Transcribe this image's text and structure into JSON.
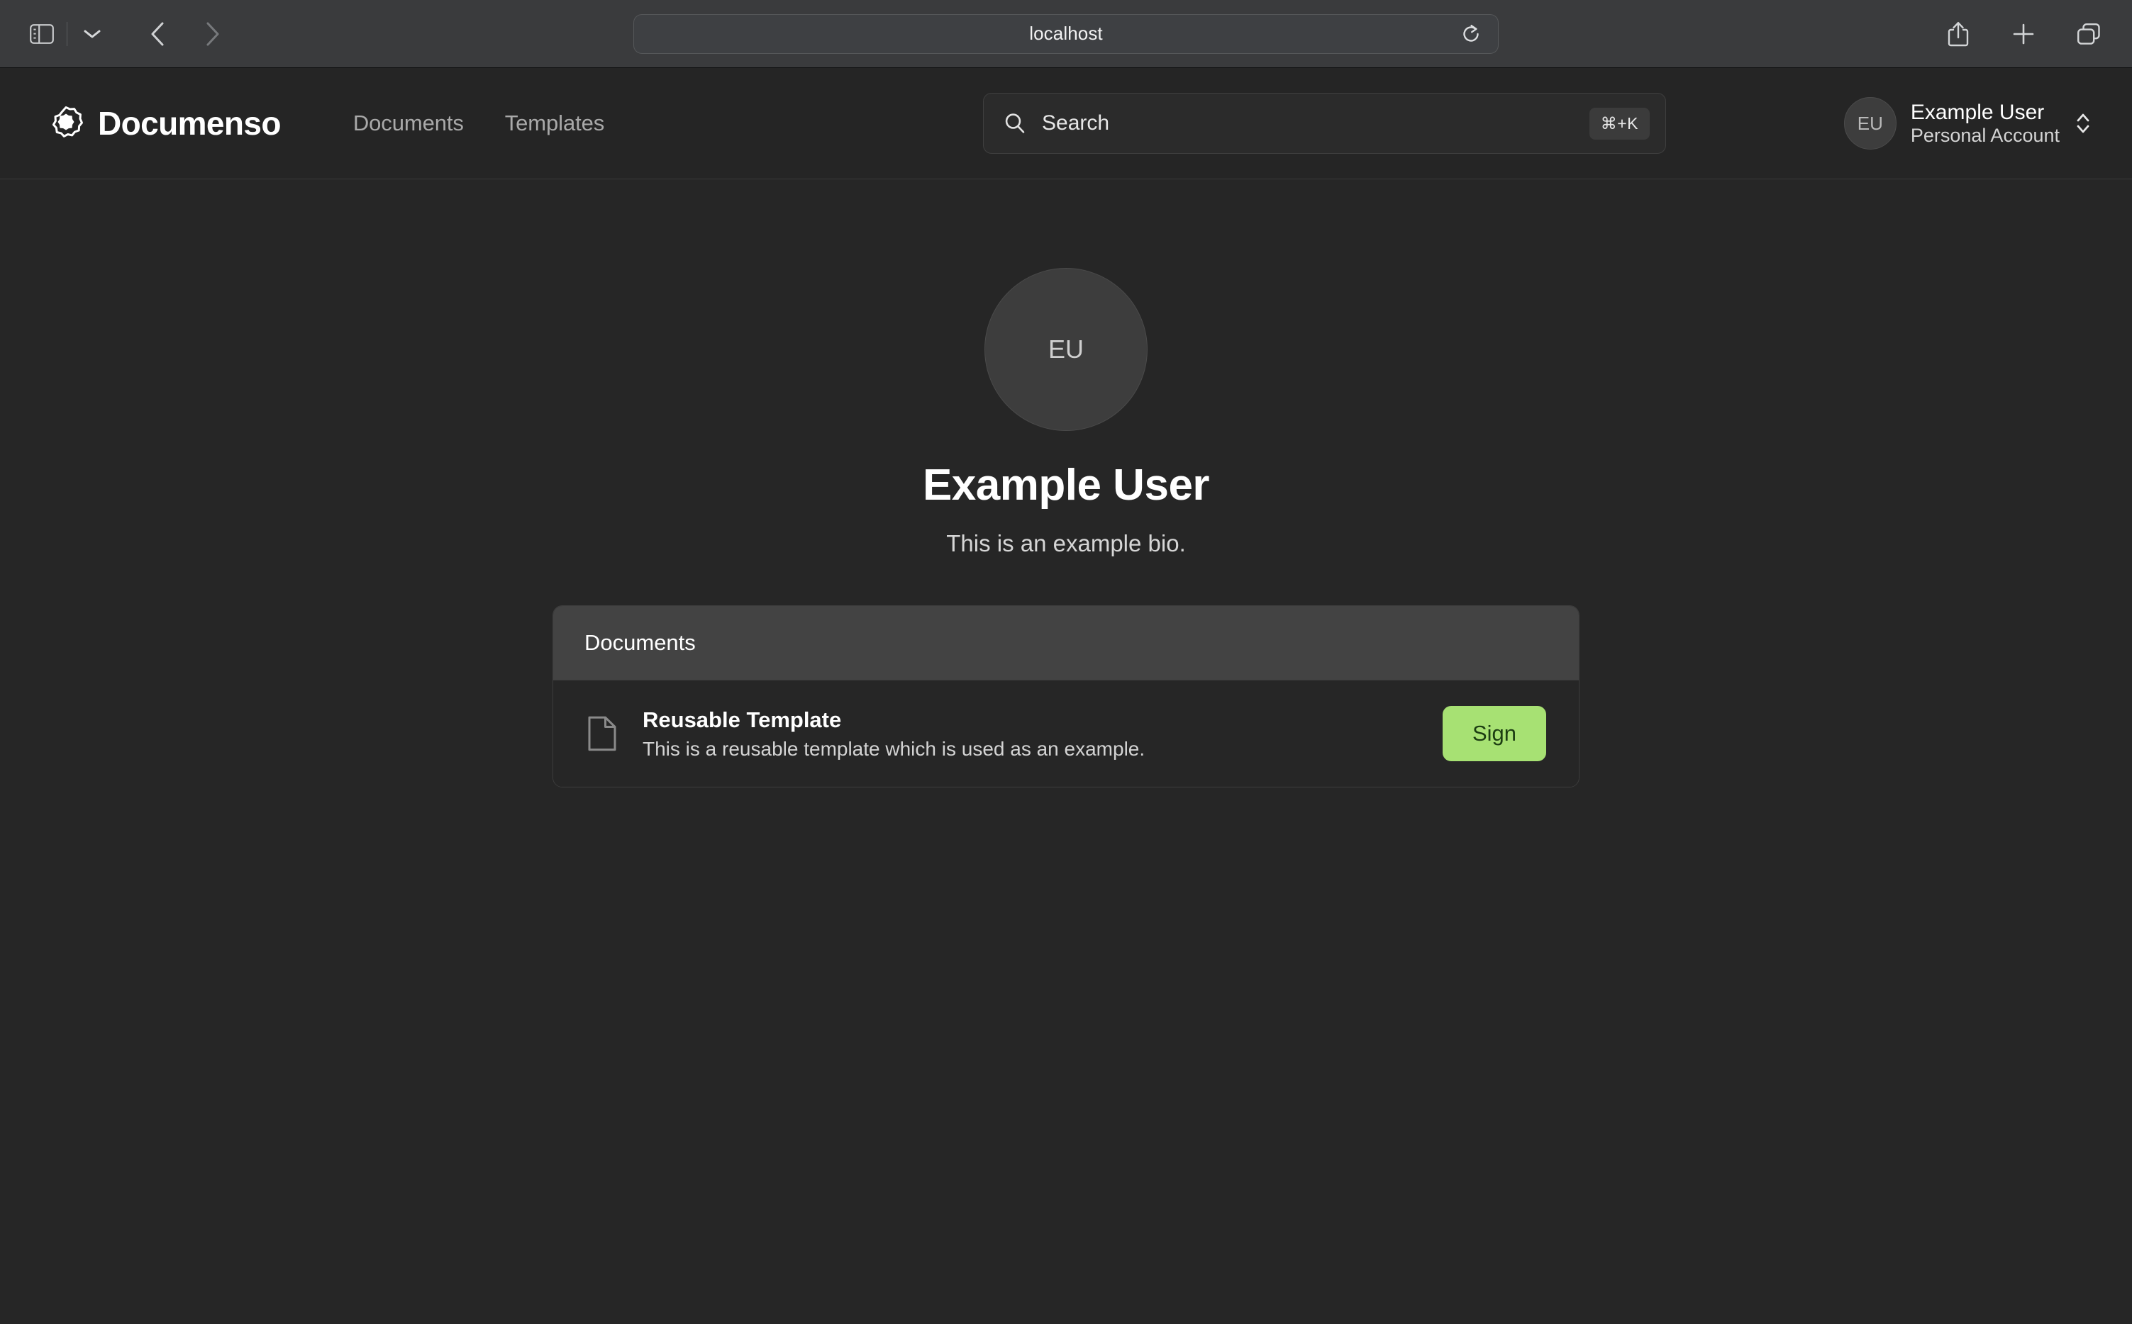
{
  "browser": {
    "url": "localhost",
    "sidebar_toggle": "sidebar-toggle",
    "tab_chevron": "chevron-down",
    "back": "back",
    "forward": "forward",
    "reload": "reload",
    "share": "share",
    "new_tab": "new-tab",
    "tab_overview": "tab-overview"
  },
  "header": {
    "brand": "Documenso",
    "nav": [
      {
        "label": "Documents"
      },
      {
        "label": "Templates"
      }
    ],
    "search": {
      "placeholder": "Search",
      "label": "Search",
      "shortcut": "⌘+K"
    },
    "account": {
      "initials": "EU",
      "name": "Example User",
      "subtitle": "Personal Account"
    }
  },
  "profile": {
    "avatar_initials": "EU",
    "name": "Example User",
    "bio": "This is an example bio."
  },
  "documents_card": {
    "title": "Documents",
    "items": [
      {
        "title": "Reusable Template",
        "description": "This is a reusable template which is used as an example.",
        "action_label": "Sign"
      }
    ]
  },
  "colors": {
    "page_bg": "#262626",
    "header_bg": "#252525",
    "chrome_bg": "#3a3b3d",
    "card_header_bg": "#434343",
    "accent_green": "#a7e173",
    "accent_green_text": "#1c3d12"
  }
}
